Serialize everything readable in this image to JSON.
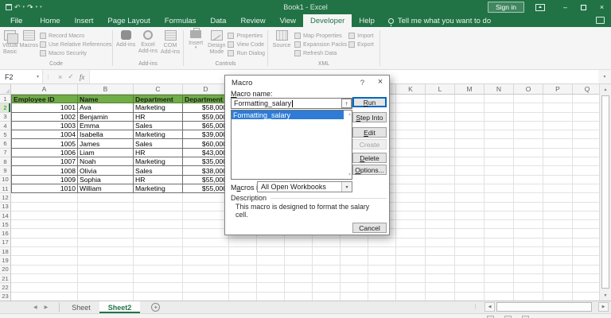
{
  "titlebar": {
    "title": "Book1 - Excel",
    "sign_in_label": "Sign in"
  },
  "tab_bar": {
    "tabs": [
      "File",
      "Home",
      "Insert",
      "Page Layout",
      "Formulas",
      "Data",
      "Review",
      "View",
      "Developer",
      "Help"
    ],
    "active_tab": "Developer",
    "tell_me_label": "Tell me what you want to do"
  },
  "ribbon": {
    "code_group": {
      "label": "Code",
      "visual_basic": "Visual Basic",
      "macros": "Macros",
      "record_macro": "Record Macro",
      "use_relative_references": "Use Relative References",
      "macro_security": "Macro Security"
    },
    "addins_group": {
      "label": "Add-ins",
      "add_ins": "Add-ins",
      "excel_add_ins": "Excel Add-ins",
      "com_add_ins": "COM Add-ins"
    },
    "controls_group": {
      "label": "Controls",
      "insert": "Insert",
      "design_mode": "Design Mode",
      "properties": "Properties",
      "view_code": "View Code",
      "run_dialog": "Run Dialog"
    },
    "xml_group": {
      "label": "XML",
      "source": "Source",
      "map_properties": "Map Properties",
      "expansion_packs": "Expansion Packs",
      "refresh_data": "Refresh Data",
      "import": "Import",
      "export": "Export"
    }
  },
  "formula_bar": {
    "name_box": "F2",
    "fx_label": "fx",
    "formula_value": ""
  },
  "grid": {
    "columns": [
      "A",
      "B",
      "C",
      "D",
      "E",
      "F",
      "G",
      "H",
      "I",
      "J",
      "K",
      "L",
      "M",
      "N",
      "O",
      "P",
      "Q"
    ],
    "row_count": 23,
    "active_row": 2,
    "table": {
      "header_row": [
        "Employee ID",
        "Name",
        "Department",
        "Department"
      ],
      "data_rows": [
        [
          "1001",
          "Ava",
          "Marketing",
          "$58,000"
        ],
        [
          "1002",
          "Benjamin",
          "HR",
          "$59,000"
        ],
        [
          "1003",
          "Emma",
          "Sales",
          "$65,000"
        ],
        [
          "1004",
          "Isabella",
          "Marketing",
          "$39,000"
        ],
        [
          "1005",
          "James",
          "Sales",
          "$60,000"
        ],
        [
          "1006",
          "Liam",
          "HR",
          "$43,000"
        ],
        [
          "1007",
          "Noah",
          "Marketing",
          "$35,000"
        ],
        [
          "1008",
          "Olivia",
          "Sales",
          "$38,000"
        ],
        [
          "1009",
          "Sophia",
          "HR",
          "$55,000"
        ],
        [
          "1010",
          "William",
          "Marketing",
          "$55,000"
        ]
      ]
    }
  },
  "macro_dialog": {
    "title": "Macro",
    "macro_name_label": "Macro name:",
    "macro_name_value": "Formatting_salary",
    "macro_list": [
      "Formatting_salary"
    ],
    "selected_macro": "Formatting_salary",
    "buttons": {
      "run": "Run",
      "step_into": "Step Into",
      "edit": "Edit",
      "create": "Create",
      "delete": "Delete",
      "options": "Options...",
      "cancel": "Cancel"
    },
    "macros_in_label": "Macros in:",
    "macros_in_value": "All Open Workbooks",
    "description_label": "Description",
    "description_text": "This macro is designed to format the salary cell."
  },
  "sheet_tab_bar": {
    "sheet_tabs": [
      "Sheet",
      "Sheet2"
    ],
    "active_sheet": "Sheet2"
  },
  "icons": {
    "undo": "↶",
    "redo": "↷",
    "dropdown": "▾",
    "minimize": "–",
    "close": "×",
    "help": "?",
    "up_arrow": "↑",
    "check": "✓",
    "cancel_x": "×",
    "scroll_up": "▲",
    "scroll_down": "▼",
    "scroll_left": "◀",
    "scroll_right": "▶",
    "list_up": "▴",
    "list_down": "▾",
    "plus": "+",
    "dots": "⋮"
  },
  "colors": {
    "excel_green": "#217346",
    "table_header_green": "#70AD47",
    "selection_blue": "#2E7CD6",
    "default_button_border": "#0067C0"
  }
}
